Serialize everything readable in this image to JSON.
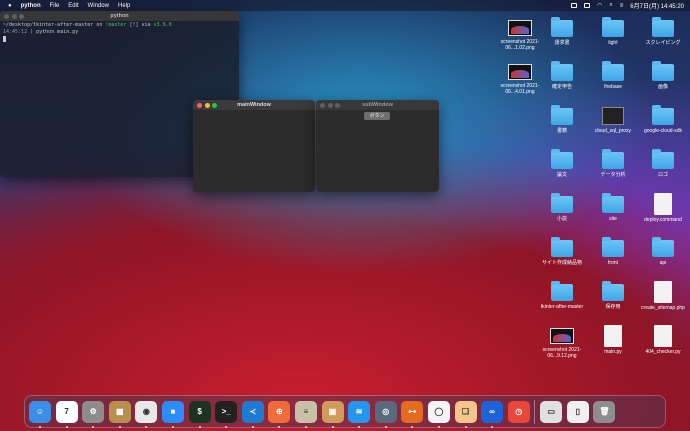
{
  "menubar": {
    "app": "python",
    "items": [
      "File",
      "Edit",
      "Window",
      "Help"
    ],
    "clock": "6月7日(月) 14:45:20"
  },
  "terminal": {
    "title": "python",
    "path": "~/desktop/tkinter-after-master",
    "on": "on",
    "branch": "master",
    "flags": "[!]",
    "via": "via",
    "version": "v3.9.0",
    "time": "14:45:12",
    "command": "python main.py"
  },
  "main_window": {
    "title": "mainWindow"
  },
  "sub_window": {
    "title": "subWindow",
    "button": "ボタン"
  },
  "desktop": [
    {
      "label": "screenshot 2021-06...1.02.png",
      "icon": "screenshot"
    },
    {
      "label": "請求書",
      "icon": "folder"
    },
    {
      "label": "light",
      "icon": "folder"
    },
    {
      "label": "スクレイピング",
      "icon": "folder"
    },
    {
      "label": "screenshot 2021-06...4.01.png",
      "icon": "screenshot"
    },
    {
      "label": "確定申告",
      "icon": "folder"
    },
    {
      "label": "firebase",
      "icon": "folder"
    },
    {
      "label": "画像",
      "icon": "folder"
    },
    {
      "label": "",
      "icon": ""
    },
    {
      "label": "書籍",
      "icon": "folder"
    },
    {
      "label": "cloud_sql_proxy",
      "icon": "exec"
    },
    {
      "label": "google-cloud-sdk",
      "icon": "folder"
    },
    {
      "label": "",
      "icon": ""
    },
    {
      "label": "論文",
      "icon": "folder"
    },
    {
      "label": "データ分析",
      "icon": "folder"
    },
    {
      "label": "ロゴ",
      "icon": "folder"
    },
    {
      "label": "",
      "icon": ""
    },
    {
      "label": "小説",
      "icon": "folder"
    },
    {
      "label": "site",
      "icon": "folder"
    },
    {
      "label": "deploy.command",
      "icon": "file"
    },
    {
      "label": "",
      "icon": ""
    },
    {
      "label": "サイト作成納品物",
      "icon": "folder"
    },
    {
      "label": "front",
      "icon": "folder"
    },
    {
      "label": "api",
      "icon": "folder"
    },
    {
      "label": "",
      "icon": ""
    },
    {
      "label": "tkinter-after-master",
      "icon": "folder"
    },
    {
      "label": "保存用",
      "icon": "folder"
    },
    {
      "label": "create_sitemap.php",
      "icon": "file"
    },
    {
      "label": "",
      "icon": ""
    },
    {
      "label": "screenshot 2021-06...9.12.png",
      "icon": "screenshot"
    },
    {
      "label": "main.py",
      "icon": "file"
    },
    {
      "label": "404_checker.py",
      "icon": "file"
    }
  ],
  "dock": [
    {
      "name": "finder",
      "color": "#3a8ee6",
      "glyph": "☺"
    },
    {
      "name": "calendar",
      "color": "#ffffff",
      "glyph": "7"
    },
    {
      "name": "system-preferences",
      "color": "#8c8c8c",
      "glyph": "⚙"
    },
    {
      "name": "archive",
      "color": "#b8904e",
      "glyph": "▦"
    },
    {
      "name": "chrome",
      "color": "#e8e8e8",
      "glyph": "◉"
    },
    {
      "name": "zoom",
      "color": "#2d8cff",
      "glyph": "■"
    },
    {
      "name": "terminal-green",
      "color": "#1d3320",
      "glyph": "$"
    },
    {
      "name": "terminal",
      "color": "#222222",
      "glyph": ">_"
    },
    {
      "name": "vscode",
      "color": "#1f7ad1",
      "glyph": "≺"
    },
    {
      "name": "safari",
      "color": "#f06b3a",
      "glyph": "⊕"
    },
    {
      "name": "sequel",
      "color": "#c8c0a8",
      "glyph": "≡"
    },
    {
      "name": "package",
      "color": "#d09a5a",
      "glyph": "▣"
    },
    {
      "name": "docker",
      "color": "#2496ed",
      "glyph": "≋"
    },
    {
      "name": "disk-utility",
      "color": "#5a6a7a",
      "glyph": "◎"
    },
    {
      "name": "sourcetree",
      "color": "#e56a22",
      "glyph": "⊶"
    },
    {
      "name": "mongodb",
      "color": "#f4f4f4",
      "glyph": "◯"
    },
    {
      "name": "preview",
      "color": "#f3c58a",
      "glyph": "❏"
    },
    {
      "name": "infinity",
      "color": "#1e63d6",
      "glyph": "∞"
    },
    {
      "name": "clock",
      "color": "#e8473a",
      "glyph": "◷"
    },
    {
      "name": "photos",
      "color": "#e0e0e0",
      "glyph": "▭"
    },
    {
      "name": "document",
      "color": "#f0f0f0",
      "glyph": "▯"
    },
    {
      "name": "trash",
      "color": "#8d8d8d",
      "glyph": "🗑"
    }
  ]
}
